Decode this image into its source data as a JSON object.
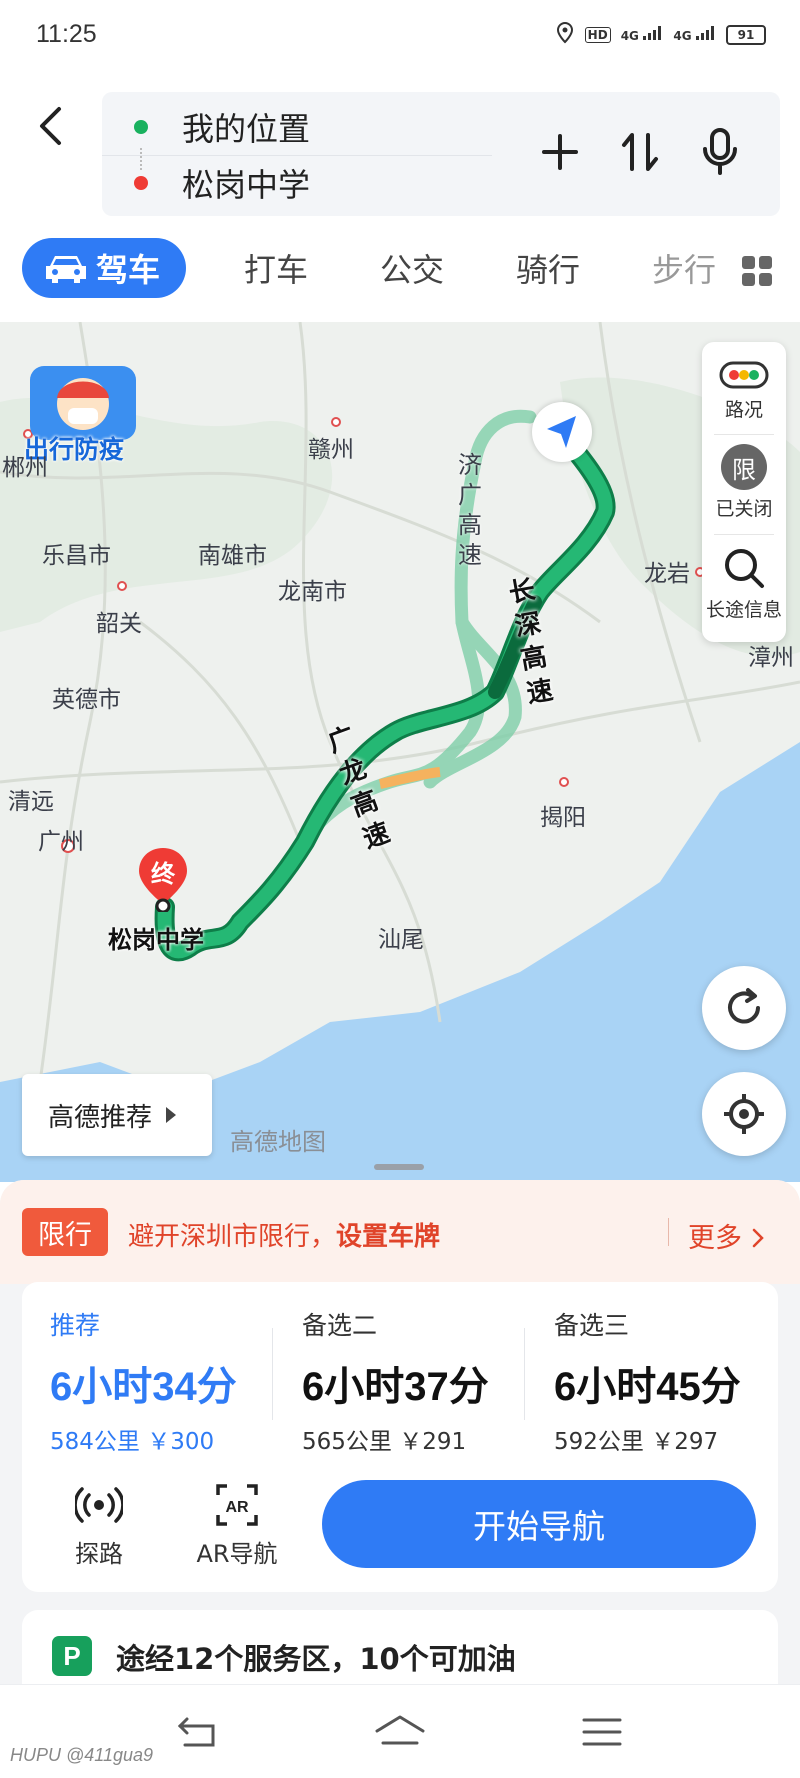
{
  "status_bar": {
    "time": "11:25",
    "network": "4G",
    "battery": "91"
  },
  "route": {
    "start": "我的位置",
    "end": "松岗中学"
  },
  "tabs": [
    {
      "label": "驾车",
      "active": true
    },
    {
      "label": "打车"
    },
    {
      "label": "公交"
    },
    {
      "label": "骑行"
    },
    {
      "label": "步行"
    }
  ],
  "map": {
    "promo_label": "出行防疫",
    "side_controls": {
      "traffic": "路况",
      "restrict": "已关闭",
      "restrict_icon_char": "限",
      "long_trip": "长途信息"
    },
    "cities": [
      "赣州",
      "乐昌市",
      "南雄市",
      "龙南市",
      "韶关",
      "英德市",
      "清远",
      "广州",
      "揭阳",
      "汕尾",
      "龙岩",
      "漳州",
      "郴州"
    ],
    "road_labels": {
      "jiguang": "济广高速",
      "changshen": "长深高速",
      "guanglong": "广龙高速"
    },
    "end_marker": "终",
    "destination_label": "松岗中学",
    "recommend_button": "高德推荐",
    "watermark": "高德地图"
  },
  "restriction": {
    "badge": "限行",
    "text_prefix": "避开深圳市限行，",
    "text_link": "设置车牌",
    "more": "更多"
  },
  "route_options": [
    {
      "label": "推荐",
      "duration": "6小时34分",
      "distance": "584公里",
      "cost": "￥300",
      "selected": true
    },
    {
      "label": "备选二",
      "duration": "6小时37分",
      "distance": "565公里",
      "cost": "￥291",
      "selected": false
    },
    {
      "label": "备选三",
      "duration": "6小时45分",
      "distance": "592公里",
      "cost": "￥297",
      "selected": false
    }
  ],
  "tools": {
    "explore": "探路",
    "ar": "AR导航"
  },
  "start_button": "开始导航",
  "service_info": {
    "icon_char": "P",
    "text": "途经12个服务区，10个可加油"
  },
  "nav_watermark": "HUPU @411gua9",
  "colors": {
    "accent": "#2f7bf5",
    "route_green": "#1fa36a",
    "restrict_red": "#e0442a"
  }
}
